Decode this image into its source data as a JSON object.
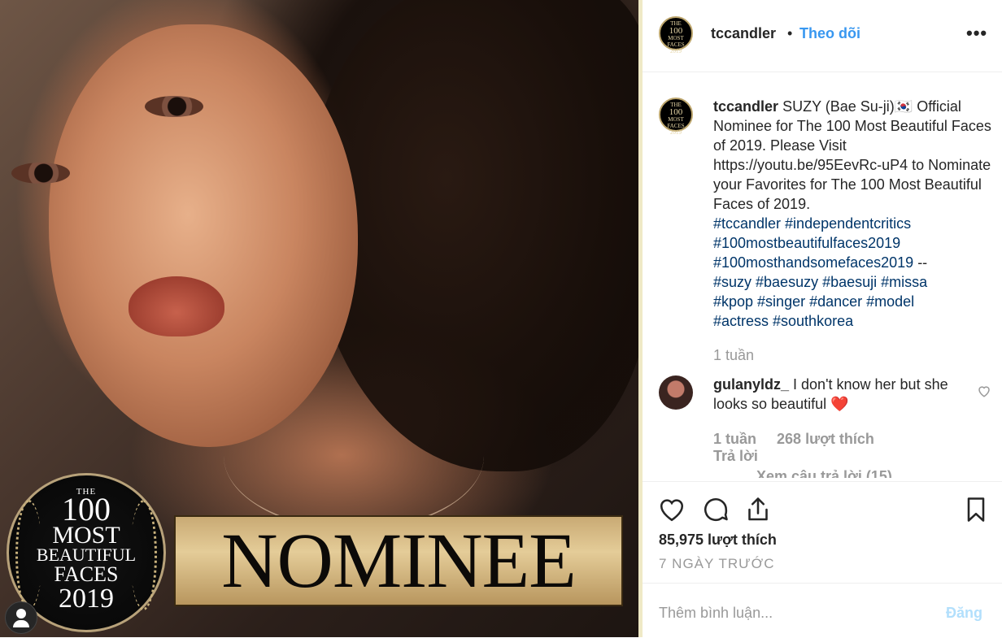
{
  "post_image": {
    "badge": {
      "line1": "THE",
      "line2": "100",
      "line3": "MOST",
      "line4": "BEAUTIFUL",
      "line5": "FACES",
      "line6": "2019"
    },
    "banner_text": "NOMINEE"
  },
  "header": {
    "username": "tccandler",
    "separator": "•",
    "follow_label": "Theo dõi",
    "more_label": "•••"
  },
  "avatar_logo": {
    "line1": "THE",
    "line2": "100",
    "line3": "MOST",
    "line4": "FACES",
    "line5": "2019"
  },
  "caption": {
    "username": "tccandler",
    "text_line1": "SUZY (Bae Su-ji)🇰🇷",
    "text_body": "Official Nominee for The 100 Most Beautiful Faces of 2019. Please Visit https://youtu.be/95EevRc-uP4 to Nominate your Favorites for The 100 Most Beautiful Faces of 2019.",
    "hashtags_1": "#tccandler #independentcritics",
    "hashtags_2": "#100mostbeautifulfaces2019",
    "hashtags_3": "#100mosthandsomefaces2019",
    "hashtags_3_suffix": " --",
    "hashtags_4": "#suzy #baesuzy #baesuji #missa",
    "hashtags_5": "#kpop #singer #dancer #model",
    "hashtags_6": "#actress #southkorea",
    "time": "1 tuần"
  },
  "comment": {
    "username": "gulanyldz_",
    "text": "I don't know her but she looks so beautiful ❤️",
    "time": "1 tuần",
    "likes": "268 lượt thích",
    "reply_label": "Trả lời",
    "view_replies": "Xem câu trả lời (15)"
  },
  "actions": {
    "likes_total": "85,975 lượt thích",
    "date": "7 NGÀY TRƯỚC"
  },
  "comment_box": {
    "placeholder": "Thêm bình luận...",
    "post_label": "Đăng"
  },
  "colors": {
    "link_blue": "#3897f0",
    "hashtag": "#003569",
    "muted": "#999999",
    "post_disabled": "#b2dffc"
  }
}
